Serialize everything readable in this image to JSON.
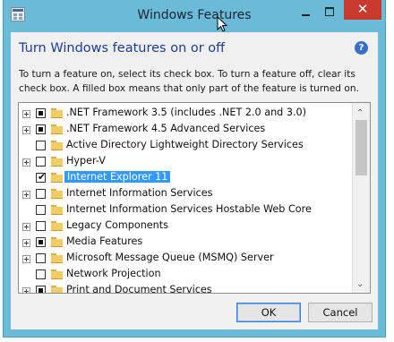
{
  "window": {
    "title": "Windows Features",
    "close_symbol": "✕"
  },
  "heading": "Turn Windows features on or off",
  "help_symbol": "?",
  "description": "To turn a feature on, select its check box. To turn a feature off, clear its check box. A filled box means that only part of the feature is turned on.",
  "features": [
    {
      "label": ".NET Framework 3.5 (includes .NET 2.0 and 3.0)",
      "state": "partial",
      "expandable": true
    },
    {
      "label": ".NET Framework 4.5 Advanced Services",
      "state": "partial",
      "expandable": true
    },
    {
      "label": "Active Directory Lightweight Directory Services",
      "state": "unchecked",
      "expandable": false
    },
    {
      "label": "Hyper-V",
      "state": "unchecked",
      "expandable": true
    },
    {
      "label": "Internet Explorer 11",
      "state": "checked",
      "expandable": false,
      "selected": true
    },
    {
      "label": "Internet Information Services",
      "state": "unchecked",
      "expandable": true
    },
    {
      "label": "Internet Information Services Hostable Web Core",
      "state": "unchecked",
      "expandable": false
    },
    {
      "label": "Legacy Components",
      "state": "unchecked",
      "expandable": true
    },
    {
      "label": "Media Features",
      "state": "partial",
      "expandable": true
    },
    {
      "label": "Microsoft Message Queue (MSMQ) Server",
      "state": "unchecked",
      "expandable": true
    },
    {
      "label": "Network Projection",
      "state": "unchecked",
      "expandable": false
    },
    {
      "label": "Print and Document Services",
      "state": "partial",
      "expandable": true
    }
  ],
  "buttons": {
    "ok": "OK",
    "cancel": "Cancel"
  },
  "colors": {
    "accent": "#1e3d91",
    "selection": "#3399ff",
    "close": "#c73a2d",
    "frame": "#6bbbd8"
  }
}
